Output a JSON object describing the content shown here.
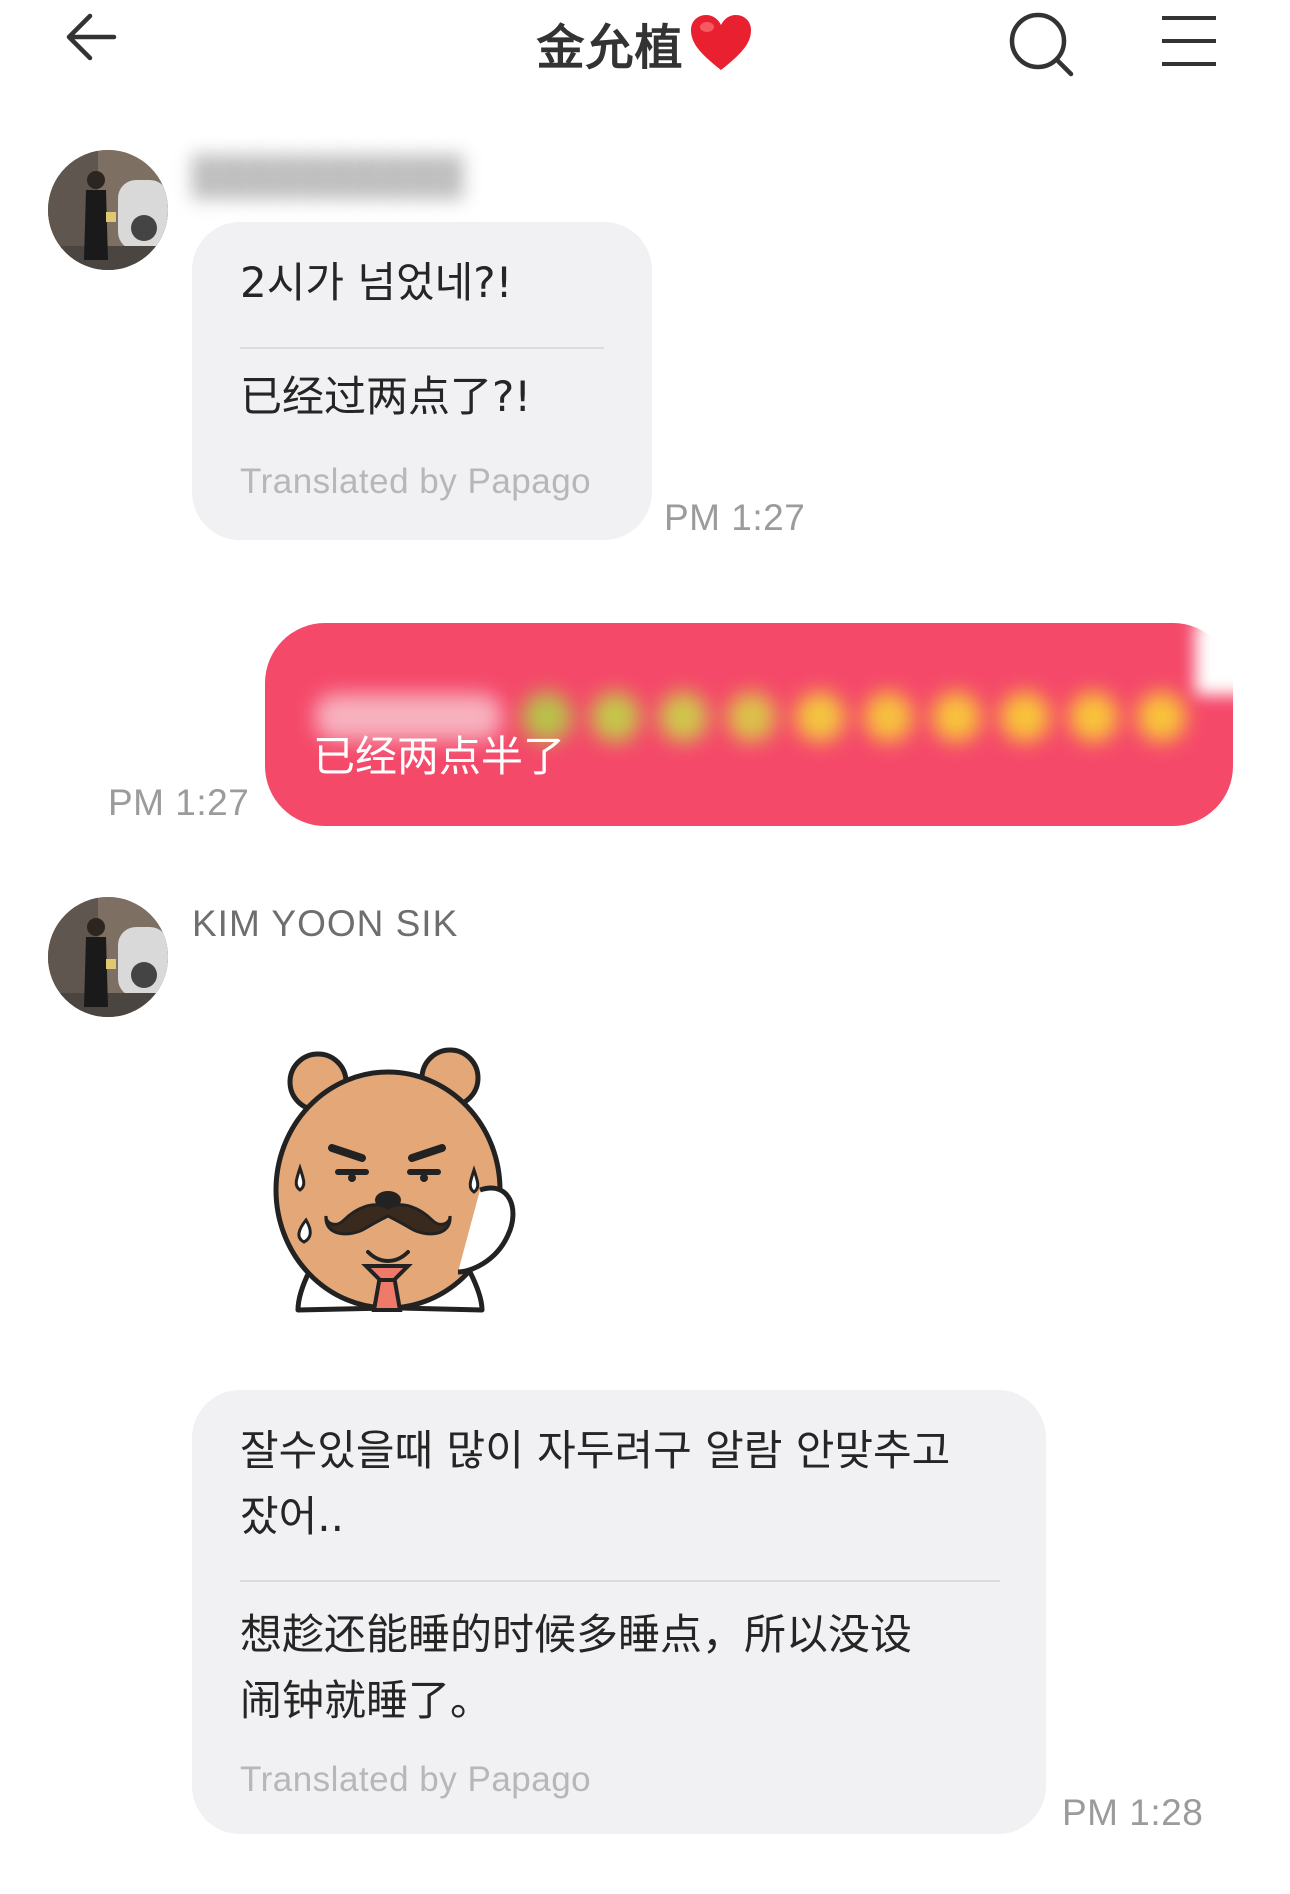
{
  "header": {
    "title": "金允植",
    "title_emoji": "❤️",
    "back_icon": "arrow-left-icon",
    "search_icon": "search-icon",
    "menu_icon": "hamburger-menu-icon"
  },
  "messages": [
    {
      "direction": "incoming",
      "sender": "",
      "original": "2시가 넘었네?!",
      "translated": "已经过两点了?!",
      "translator_note": "Translated by Papago",
      "time": "PM 1:27"
    },
    {
      "direction": "outgoing",
      "text": "已经两点半了",
      "time": "PM 1:27"
    },
    {
      "direction": "incoming",
      "sender": "KIM YOON SIK",
      "sticker": "bear-mustache-sweat-sticker"
    },
    {
      "direction": "incoming",
      "original_line1": "잘수있을때 많이 자두려구 알람 안맞추고",
      "original_line2": "잤어..",
      "translated_line1": "想趁还能睡的时候多睡点，所以没设",
      "translated_line2": "闹钟就睡了。",
      "translator_note": "Translated by Papago",
      "time": "PM 1:28"
    }
  ],
  "colors": {
    "outgoing_bubble": "#f5496a",
    "incoming_bubble": "#f1f1f3",
    "heart": "#e8202f",
    "timestamp": "#9b9b9b"
  }
}
